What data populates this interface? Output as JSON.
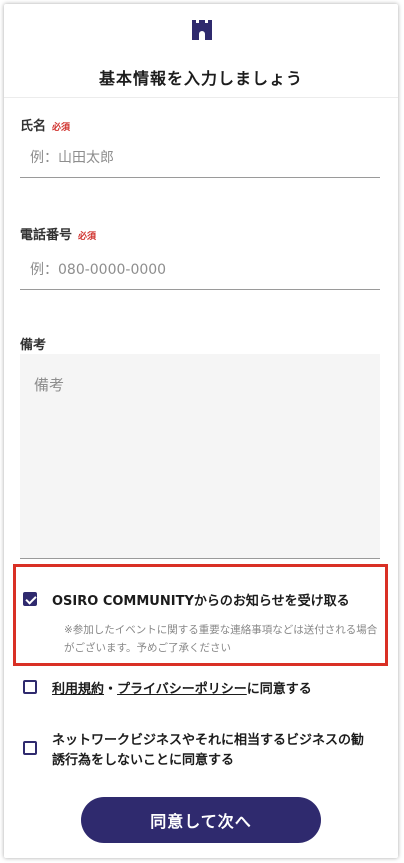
{
  "header": {
    "logo_icon": "castle-icon",
    "title": "基本情報を入力しましょう"
  },
  "form": {
    "name": {
      "label": "氏名",
      "required": "必須",
      "placeholder": "例：山田太郎",
      "value": ""
    },
    "phone": {
      "label": "電話番号",
      "required": "必須",
      "placeholder": "例：080-0000-0000",
      "value": ""
    },
    "notes": {
      "label": "備考",
      "placeholder": "備考",
      "value": ""
    }
  },
  "consents": {
    "newsletter": {
      "label": "OSIRO COMMUNITYからのお知らせを受け取る",
      "note": "※参加したイベントに関する重要な連絡事項などは送付される場合がございます。予めご了承ください",
      "checked": true
    },
    "terms": {
      "terms_link": "利用規約",
      "separator": "・",
      "privacy_link": "プライバシーポリシー",
      "suffix": "に同意する",
      "checked": false
    },
    "network": {
      "label": "ネットワークビジネスやそれに相当するビジネスの勧誘行為をしないことに同意する",
      "checked": false
    }
  },
  "submit": {
    "label": "同意して次へ"
  },
  "colors": {
    "accent": "#2f2a6e",
    "required": "#d0312d",
    "highlight": "#d93025"
  }
}
